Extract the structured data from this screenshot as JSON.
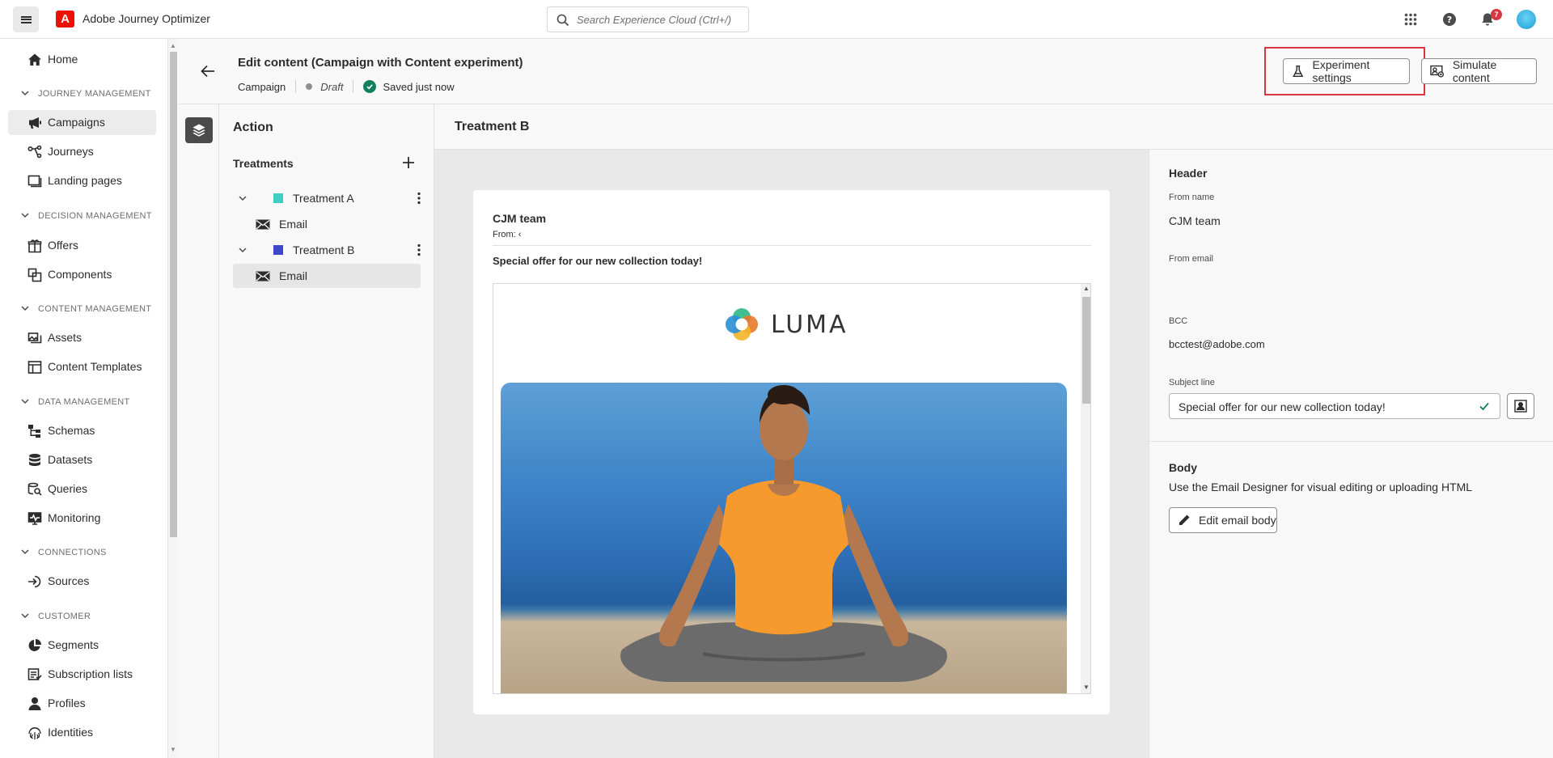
{
  "app": {
    "name": "Adobe Journey Optimizer",
    "logo_letter": "A",
    "brand_color": "#eb1000"
  },
  "search": {
    "placeholder": "Search Experience Cloud (Ctrl+/)"
  },
  "topbar": {
    "notifications_count": "7",
    "icons": [
      "apps-grid-icon",
      "help-icon",
      "bell-icon",
      "user-avatar"
    ]
  },
  "nav": {
    "home": "Home",
    "sections": [
      {
        "label": "JOURNEY MANAGEMENT",
        "items": [
          "Campaigns",
          "Journeys",
          "Landing pages"
        ]
      },
      {
        "label": "DECISION MANAGEMENT",
        "items": [
          "Offers",
          "Components"
        ]
      },
      {
        "label": "CONTENT MANAGEMENT",
        "items": [
          "Assets",
          "Content Templates"
        ]
      },
      {
        "label": "DATA MANAGEMENT",
        "items": [
          "Schemas",
          "Datasets",
          "Queries",
          "Monitoring"
        ]
      },
      {
        "label": "CONNECTIONS",
        "items": [
          "Sources"
        ]
      },
      {
        "label": "CUSTOMER",
        "items": [
          "Segments",
          "Subscription lists",
          "Profiles",
          "Identities"
        ]
      }
    ],
    "active": "Campaigns"
  },
  "header": {
    "title": "Edit content (Campaign with Content experiment)",
    "type": "Campaign",
    "status": "Draft",
    "saved": "Saved just now",
    "experiment_settings": "Experiment settings",
    "simulate_content": "Simulate content"
  },
  "action": {
    "title": "Action",
    "treatments_label": "Treatments",
    "treatments": [
      {
        "name": "Treatment A",
        "color": "#3ecec3",
        "channel": "Email"
      },
      {
        "name": "Treatment B",
        "color": "#4046ca",
        "channel": "Email"
      }
    ],
    "selected": "Treatment B / Email"
  },
  "editor": {
    "heading": "Treatment B",
    "preview": {
      "from_name": "CJM team",
      "from_line": "From: ‹",
      "subject": "Special offer for our new collection today!",
      "logo_text": "LUMA"
    }
  },
  "properties": {
    "header_title": "Header",
    "from_name_label": "From name",
    "from_name_value": "CJM team",
    "from_email_label": "From email",
    "bcc_label": "BCC",
    "bcc_value": "bcctest@adobe.com",
    "subject_label": "Subject line",
    "subject_value": "Special offer for our new collection today!",
    "body_title": "Body",
    "body_desc": "Use the Email Designer for visual editing or uploading HTML",
    "edit_body": "Edit email body"
  }
}
